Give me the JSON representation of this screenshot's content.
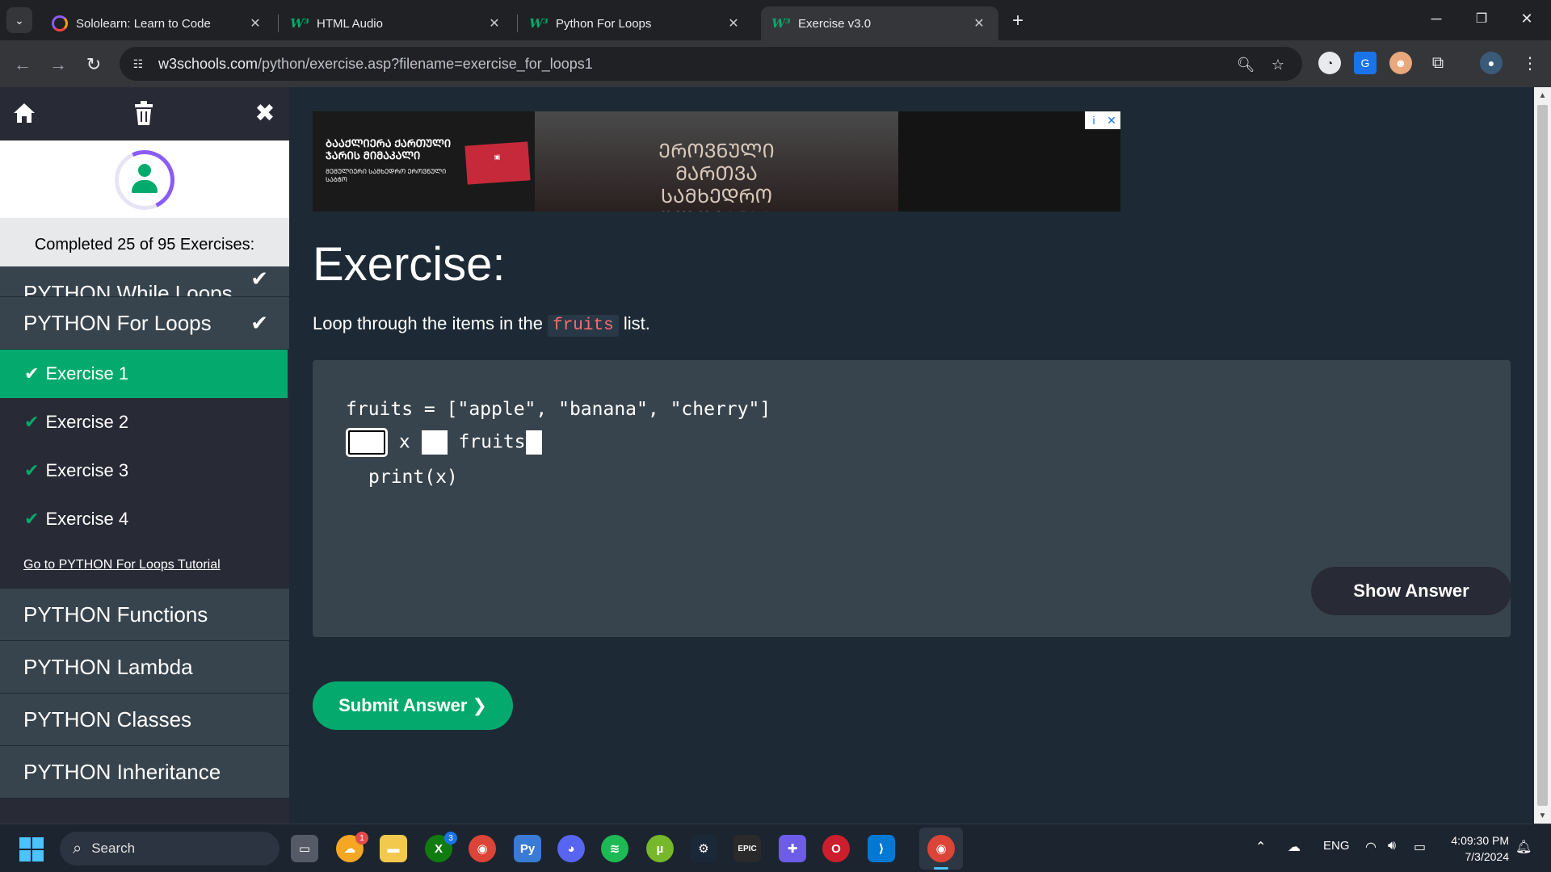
{
  "browser": {
    "tabs": [
      {
        "title": "Sololearn: Learn to Code",
        "favicon": "sololearn-icon"
      },
      {
        "title": "HTML Audio",
        "favicon": "w3schools-icon"
      },
      {
        "title": "Python For Loops",
        "favicon": "w3schools-icon"
      },
      {
        "title": "Exercise v3.0",
        "favicon": "w3schools-icon",
        "active": true
      }
    ],
    "url_host": "w3schools.com",
    "url_path": "/python/exercise.asp?filename=exercise_for_loops1"
  },
  "sidebar": {
    "progress_text": "Completed 25 of 95 Exercises:",
    "partial_item": "PYTHON While Loops",
    "current_section": "PYTHON For Loops",
    "exercises": [
      "Exercise 1",
      "Exercise 2",
      "Exercise 3",
      "Exercise 4"
    ],
    "tutorial_link": "Go to PYTHON For Loops Tutorial",
    "sections": [
      "PYTHON Functions",
      "PYTHON Lambda",
      "PYTHON Classes",
      "PYTHON Inheritance"
    ]
  },
  "ad": {
    "left_text": "ᲑᲐᲐᲥᲚᲘᲔᲠᲐ ᲥᲐᲠᲗᲣᲚᲘ ᲯᲐᲠᲘᲡ ᲛᲘᲛᲐᲙᲐᲚᲘ",
    "left_small": "ᲛᲔᲛᲣᲚᲘᲔᲠᲘ ᲡᲐᲛᲮᲔᲓᲠᲝ ᲔᲠᲝᲕᲜᲣᲚᲘ ᲡᲐᲑᲭᲝ",
    "center_text": "ᲔᲠᲝᲕᲜᲣᲚᲘ ᲛᲐᲠᲗᲕᲐ ᲡᲐᲛᲮᲔᲓᲠᲝ ᲨᲚᲝᲕᲐᲜᲑᲐ",
    "info": "i",
    "close": "✕"
  },
  "exercise": {
    "title": "Exercise:",
    "desc_before": "Loop through the items in the",
    "desc_code": "fruits",
    "desc_after": "list.",
    "code_line1": "fruits = [\"apple\", \"banana\", \"cherry\"]",
    "code_line2_var": "x",
    "code_line2_iter": "fruits",
    "code_line3": "print(x)",
    "show_answer": "Show Answer",
    "submit": "Submit Answer ❯"
  },
  "taskbar": {
    "search": "Search",
    "lang": "ENG",
    "time": "4:09:30 PM",
    "date": "7/3/2024",
    "badges": {
      "weather": "1",
      "xbox": "3"
    }
  },
  "colors": {
    "accent": "#04aa6d",
    "page_bg": "#1d2a35",
    "sidebar_item": "#38444d"
  }
}
